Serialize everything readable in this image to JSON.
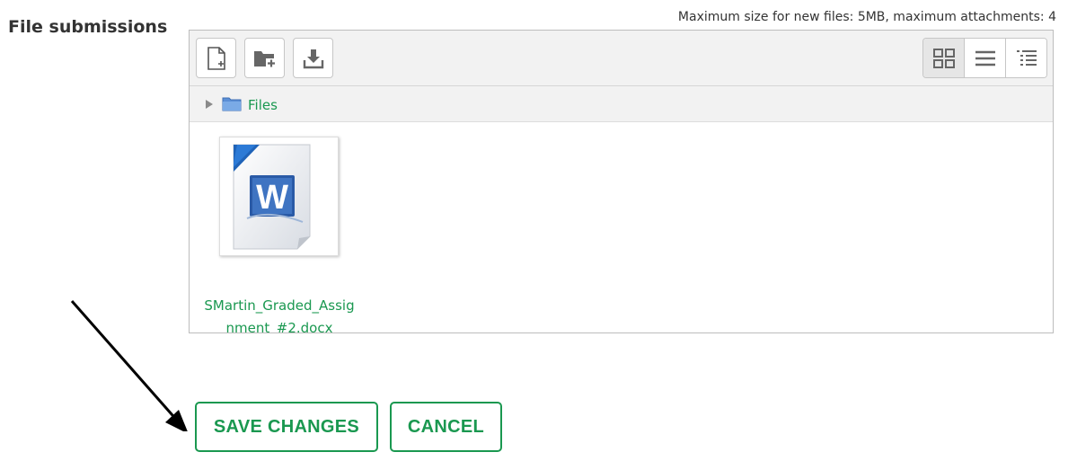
{
  "field": {
    "label": "File submissions"
  },
  "limits": {
    "text": "Maximum size for new files: 5MB, maximum attachments: 4"
  },
  "toolbar": {
    "buttons": [
      {
        "icon": "add-file-icon"
      },
      {
        "icon": "create-folder-icon"
      },
      {
        "icon": "download-icon"
      }
    ],
    "views": [
      {
        "icon": "grid-view-icon",
        "active": true
      },
      {
        "icon": "list-view-icon",
        "active": false
      },
      {
        "icon": "tree-view-icon",
        "active": false
      }
    ]
  },
  "path": {
    "folder_label": "Files"
  },
  "files": [
    {
      "name": "SMartin_Graded_Assignment_#2.docx",
      "icon": "word-document-icon"
    }
  ],
  "actions": {
    "save_label": "SAVE CHANGES",
    "cancel_label": "CANCEL"
  },
  "colors": {
    "accent": "#1a9850",
    "word_blue": "#2a5aa6"
  }
}
